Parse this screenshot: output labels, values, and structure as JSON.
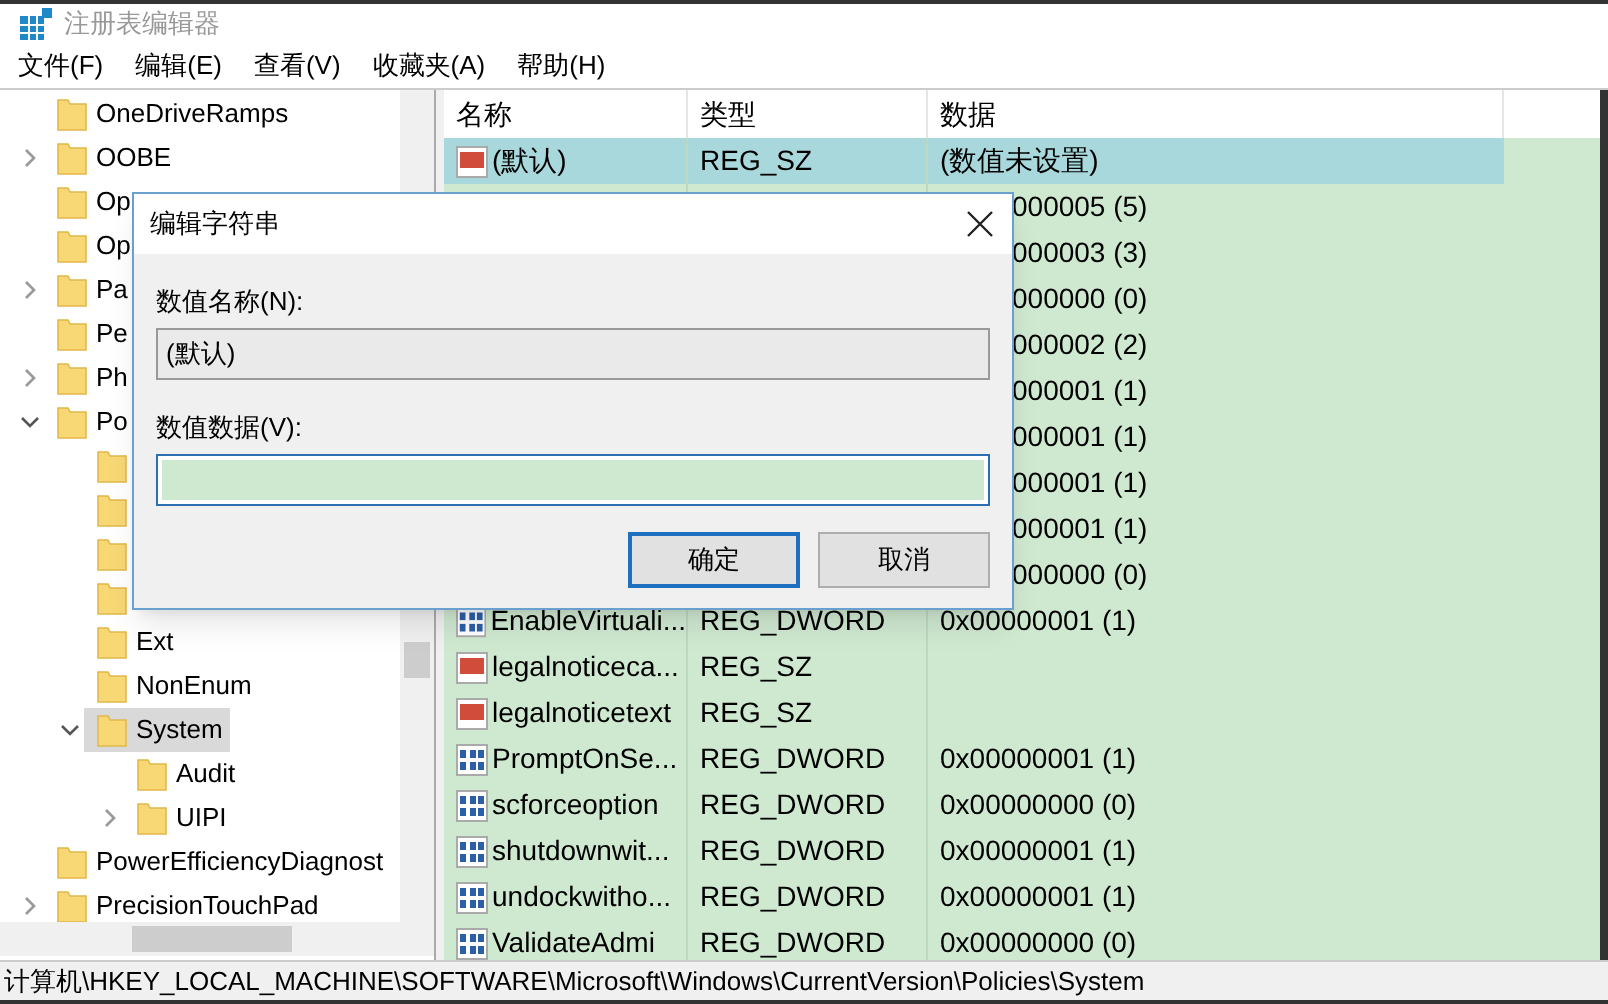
{
  "window": {
    "title": "注册表编辑器"
  },
  "menu": [
    "文件(F)",
    "编辑(E)",
    "查看(V)",
    "收藏夹(A)",
    "帮助(H)"
  ],
  "tree": [
    {
      "label": "OneDriveRamps",
      "selected": false
    },
    {
      "label": "OOBE",
      "expanded": false,
      "selected": false
    },
    {
      "label": "Op",
      "selected": false
    },
    {
      "label": "Op",
      "selected": false
    },
    {
      "label": "Pa",
      "expanded": false,
      "selected": false
    },
    {
      "label": "Pe",
      "selected": false
    },
    {
      "label": "Ph",
      "expanded": false,
      "selected": false
    },
    {
      "label": "Po",
      "expanded": true,
      "selected": false,
      "children": [
        {
          "selected": false
        },
        {
          "selected": false
        },
        {
          "selected": false
        },
        {
          "selected": false
        },
        {
          "label": "Ext",
          "selected": false
        },
        {
          "label": "NonEnum",
          "selected": false
        },
        {
          "label": "System",
          "expanded": true,
          "selected": true,
          "children": [
            {
              "label": "Audit",
              "selected": false
            },
            {
              "label": "UIPI",
              "expanded": false,
              "selected": false
            }
          ]
        }
      ]
    },
    {
      "label": "PowerEfficiencyDiagnost",
      "selected": false
    },
    {
      "label": "PrecisionTouchPad",
      "expanded": false,
      "selected": false
    }
  ],
  "table": {
    "columns": [
      "名称",
      "类型",
      "数据"
    ],
    "rows": [
      {
        "kind": "sz",
        "name": "(默认)",
        "type": "REG_SZ",
        "data": "(数值未设置)",
        "selected": true
      },
      {
        "data": "000005 (5)",
        "selected": false
      },
      {
        "data": "000003 (3)",
        "selected": false
      },
      {
        "data": "000000 (0)",
        "selected": false
      },
      {
        "data": "000002 (2)",
        "selected": false
      },
      {
        "data": "000001 (1)",
        "selected": false
      },
      {
        "data": "000001 (1)",
        "selected": false
      },
      {
        "data": "000001 (1)",
        "selected": false
      },
      {
        "data": "000001 (1)",
        "selected": false
      },
      {
        "data": "000000 (0)",
        "selected": false
      },
      {
        "kind": "dword",
        "name": "EnableVirtuali...",
        "type": "REG_DWORD",
        "data": "0x00000001 (1)",
        "selected": false
      },
      {
        "kind": "sz",
        "name": "legalnoticeca...",
        "type": "REG_SZ",
        "selected": false
      },
      {
        "kind": "sz",
        "name": "legalnoticetext",
        "type": "REG_SZ",
        "selected": false
      },
      {
        "kind": "dword",
        "name": "PromptOnSe...",
        "type": "REG_DWORD",
        "data": "0x00000001 (1)",
        "selected": false
      },
      {
        "kind": "dword",
        "name": "scforceoption",
        "type": "REG_DWORD",
        "data": "0x00000000 (0)",
        "selected": false
      },
      {
        "kind": "dword",
        "name": "shutdownwit...",
        "type": "REG_DWORD",
        "data": "0x00000001 (1)",
        "selected": false
      },
      {
        "kind": "dword",
        "name": "undockwitho...",
        "type": "REG_DWORD",
        "data": "0x00000001 (1)",
        "selected": false
      },
      {
        "kind": "dword",
        "name": "ValidateAdmi",
        "type": "REG_DWORD",
        "data": "0x00000000 (0)",
        "selected": false
      }
    ]
  },
  "dialog": {
    "title": "编辑字符串",
    "name_label": "数值名称(N):",
    "name_value": "(默认)",
    "data_label": "数值数据(V):",
    "buttons": [
      {
        "label": "确定",
        "default": true
      },
      {
        "label": "取消",
        "default": false
      }
    ]
  },
  "status_bar": "计算机\\HKEY_LOCAL_MACHINE\\SOFTWARE\\Microsoft\\Windows\\CurrentVersion\\Policies\\System"
}
